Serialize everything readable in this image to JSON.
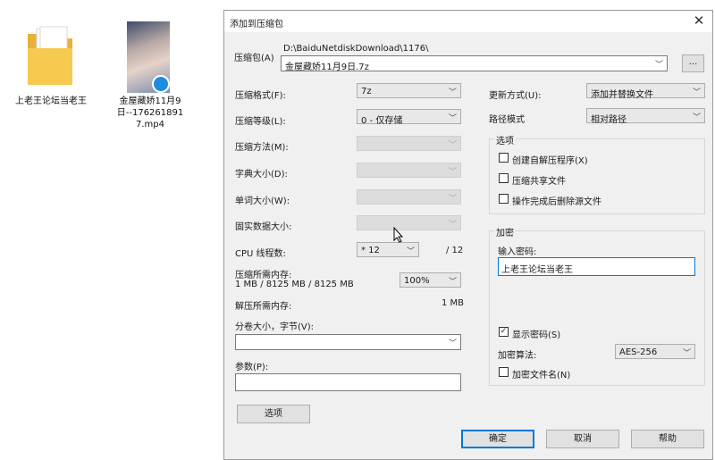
{
  "desktop": {
    "folder_label": "上老王论坛当老王",
    "video_label": "金屋藏娇11月9日--1762618917.mp4"
  },
  "dialog": {
    "title": "添加到压缩包",
    "archive": {
      "label": "压缩包(A)",
      "path": "D:\\BaiduNetdiskDownload\\1176\\",
      "filename": "金屋藏娇11月9日.7z",
      "browse": "..."
    },
    "left": {
      "format": {
        "label": "压缩格式(F):",
        "value": "7z"
      },
      "level": {
        "label": "压缩等级(L):",
        "value": "0 - 仅存储"
      },
      "method": {
        "label": "压缩方法(M):"
      },
      "dict": {
        "label": "字典大小(D):"
      },
      "word": {
        "label": "单词大小(W):"
      },
      "solid": {
        "label": "固实数据大小:"
      },
      "cpu": {
        "label": "CPU 线程数:",
        "value": "* 12",
        "max": "/ 12"
      },
      "mem_comp": {
        "label": "压缩所需内存:",
        "detail": "1 MB / 8125 MB / 8125 MB",
        "percent": "100%"
      },
      "mem_decomp": {
        "label": "解压所需内存:",
        "value": "1 MB"
      },
      "split": {
        "label": "分卷大小，字节(V):",
        "value": ""
      },
      "params": {
        "label": "参数(P):",
        "value": ""
      },
      "options_button": "选项"
    },
    "right": {
      "update": {
        "label": "更新方式(U):",
        "value": "添加并替换文件"
      },
      "pathmode": {
        "label": "路径模式",
        "value": "相对路径"
      },
      "options": {
        "title": "选项",
        "sfx": "创建自解压程序(X)",
        "shared": "压缩共享文件",
        "delete": "操作完成后删除源文件"
      },
      "encryption": {
        "title": "加密",
        "password_label": "输入密码:",
        "password_value": "上老王论坛当老王",
        "show_password": "显示密码(S)",
        "method_label": "加密算法:",
        "method_value": "AES-256",
        "encrypt_names": "加密文件名(N)"
      }
    },
    "buttons": {
      "ok": "确定",
      "cancel": "取消",
      "help": "帮助"
    }
  }
}
